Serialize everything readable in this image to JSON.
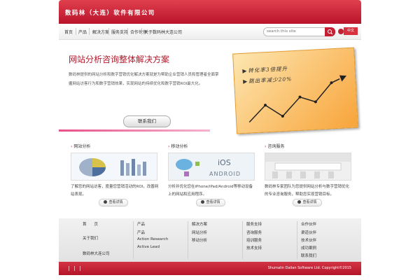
{
  "header": {
    "company_name": "数码林（大连）软件有限公司"
  },
  "nav": {
    "items": [
      "首页",
      "产品",
      "解决方案",
      "服务支持",
      "合作伙伴",
      "关于数码林大连公司"
    ],
    "search_placeholder": "search this site",
    "lang_label": "中文"
  },
  "hero": {
    "title": "网站分析咨询整体解决方案",
    "description": "数码林提供的网站分析和数字营销优化解决方案就是为帮助企业营销人员和管理者全面掌握网站访客行为和数字营销效果，实现网站的持续优化和数字营销ROI最大化。",
    "contact_button": "联系我们",
    "panel_line1": "转化率3倍提升",
    "panel_line2": "跳出率减少20%"
  },
  "features": [
    {
      "title": "网站分析",
      "text": "了解您的网站访客，度量您营销活动的ROI，改善网站表现。",
      "button": "查看详情"
    },
    {
      "title": "移动分析",
      "text": "分析并优化您在iPhone/iPad/Android等移动设备上的网站和应用程序。",
      "button": "查看详情"
    },
    {
      "title": "咨询服务",
      "text": "数码林专家团队为您提供网站分析与数字营销优化的专业咨询服务，帮助您实现营销目标。",
      "button": "查看详情"
    }
  ],
  "footer": {
    "col1": [
      "首　　页",
      "关于我们",
      "数码林大连公司"
    ],
    "col2": [
      "产品",
      "产品",
      "Action Research",
      "Active Lead"
    ],
    "col3": [
      "解决方案",
      "网站分析",
      "移动分析"
    ],
    "col4": [
      "服务支持",
      "咨询服务",
      "培训服务",
      "技术支持"
    ],
    "col5": [
      "合作伙伴",
      "渠道伙伴",
      "技术伙伴",
      "成功案例",
      "联系我们"
    ]
  },
  "bottom": {
    "copyright": "Shumalin Dalian Software Ltd. Copyright©2015"
  },
  "colors": {
    "brand_red": "#c41f32",
    "accent_pink": "#e8508a",
    "panel_orange": "#f8a43a"
  }
}
